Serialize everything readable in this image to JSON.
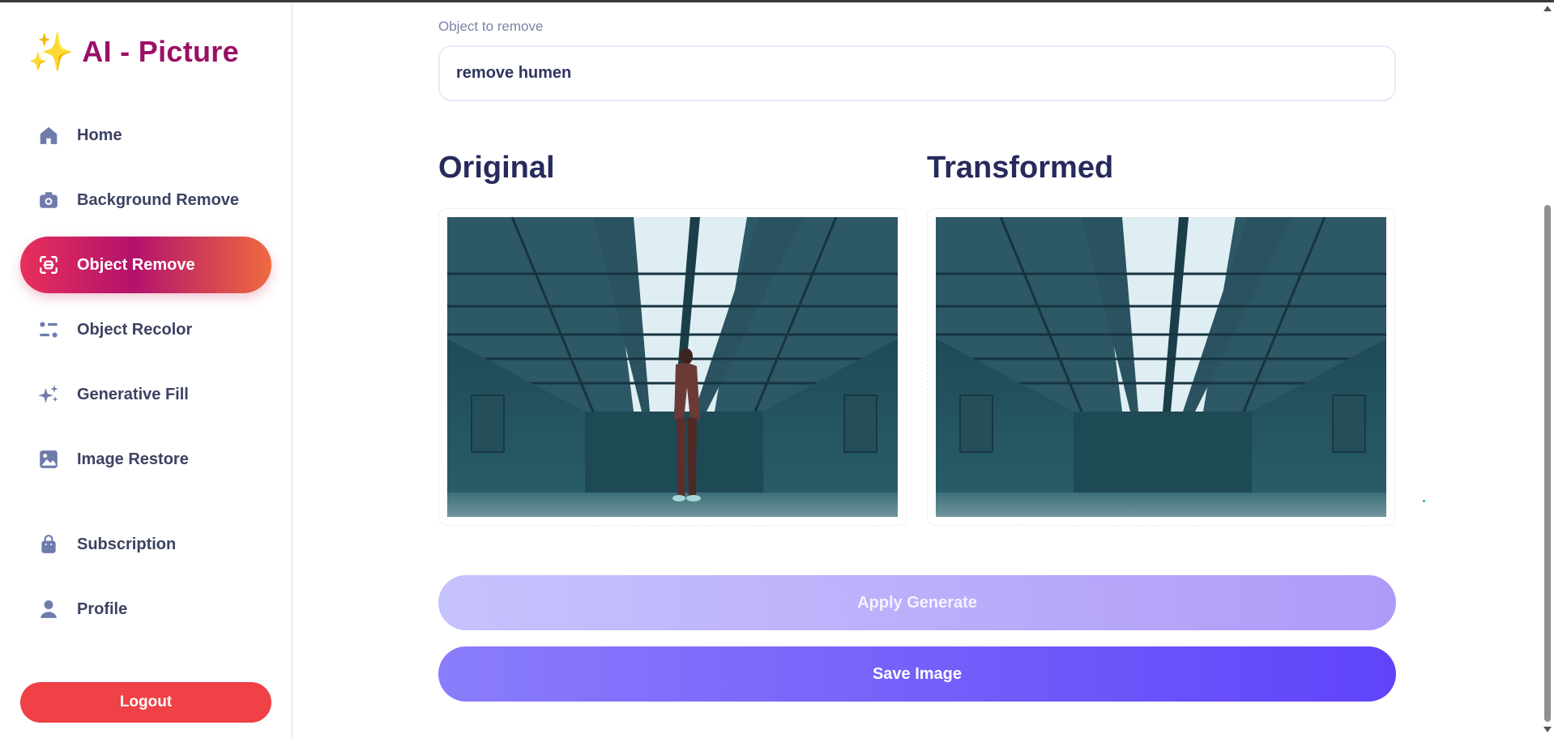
{
  "app": {
    "title": "AI - Picture",
    "logo_icon": "sparkles-icon"
  },
  "sidebar": {
    "items": [
      {
        "label": "Home",
        "icon": "home-icon",
        "active": false
      },
      {
        "label": "Background Remove",
        "icon": "camera-icon",
        "active": false
      },
      {
        "label": "Object Remove",
        "icon": "scan-icon",
        "active": true
      },
      {
        "label": "Object Recolor",
        "icon": "filter-icon",
        "active": false
      },
      {
        "label": "Generative Fill",
        "icon": "stars-icon",
        "active": false
      },
      {
        "label": "Image Restore",
        "icon": "image-icon",
        "active": false
      },
      {
        "label": "Subscription",
        "icon": "bag-icon",
        "active": false
      },
      {
        "label": "Profile",
        "icon": "user-icon",
        "active": false
      }
    ],
    "logout_label": "Logout"
  },
  "form": {
    "label": "Object to remove",
    "value": "remove humen"
  },
  "compare": {
    "original_title": "Original",
    "transformed_title": "Transformed"
  },
  "actions": {
    "apply_label": "Apply Generate",
    "save_label": "Save Image"
  },
  "colors": {
    "brand": "#9b0f66",
    "active_gradient_start": "#e7305b",
    "active_gradient_end": "#ee6a40",
    "logout": "#ef4146",
    "save_button_start": "#8a7dfb",
    "save_button_end": "#5f44fa"
  }
}
